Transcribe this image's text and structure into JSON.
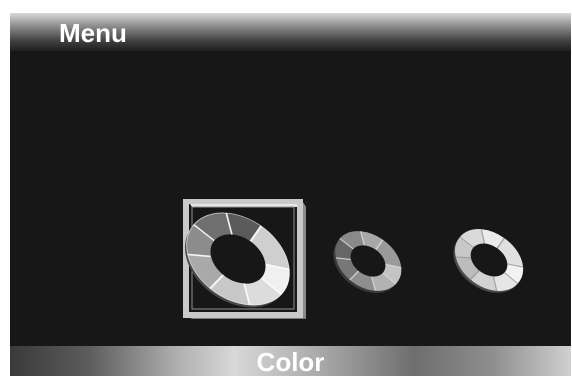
{
  "header": {
    "title": "Menu"
  },
  "footer": {
    "label": "Color"
  },
  "menu_items": [
    {
      "icon": "color-wheel-icon",
      "selected": true
    },
    {
      "icon": "color-wheel-icon",
      "selected": false
    },
    {
      "icon": "color-wheel-icon",
      "selected": false
    }
  ],
  "colors": {
    "background": "#171717",
    "selection_frame": "#bdbdbd"
  }
}
